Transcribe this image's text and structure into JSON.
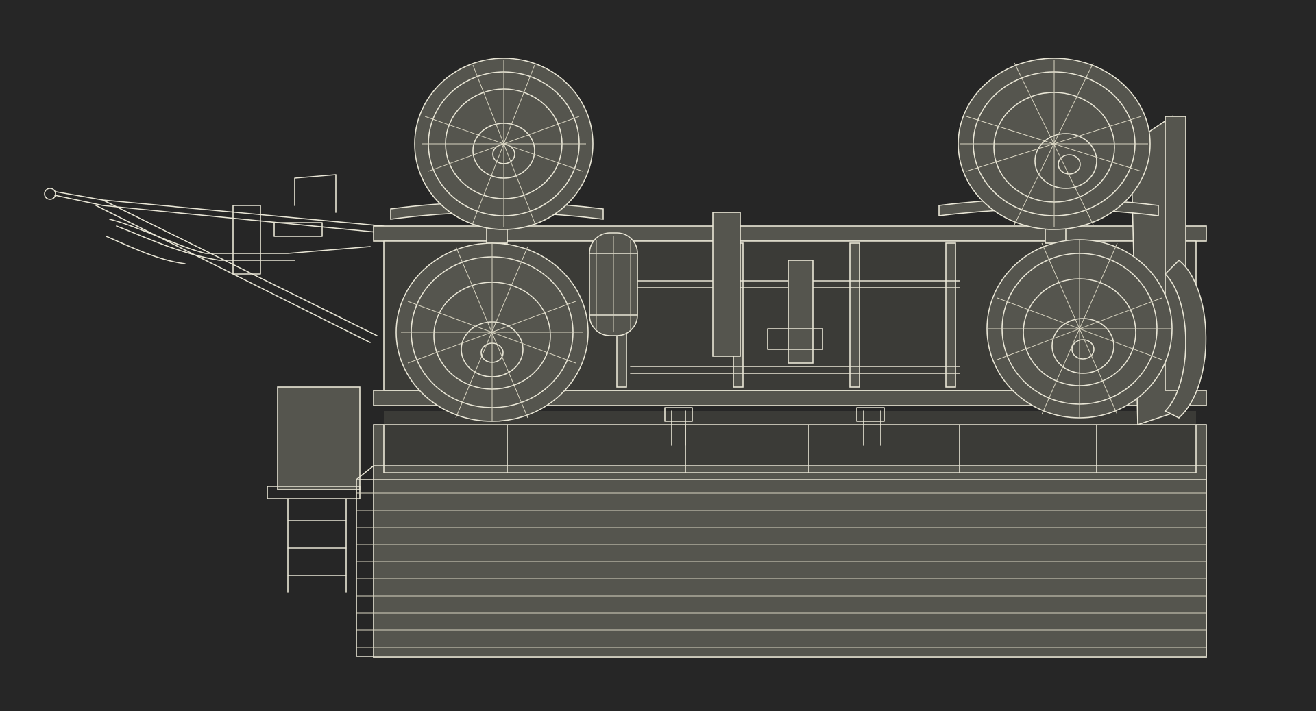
{
  "scene": {
    "background": "#262626",
    "wire_color": "#e9e6d6",
    "shade_color": "#3b3b37",
    "frame_color": "#55554e"
  }
}
